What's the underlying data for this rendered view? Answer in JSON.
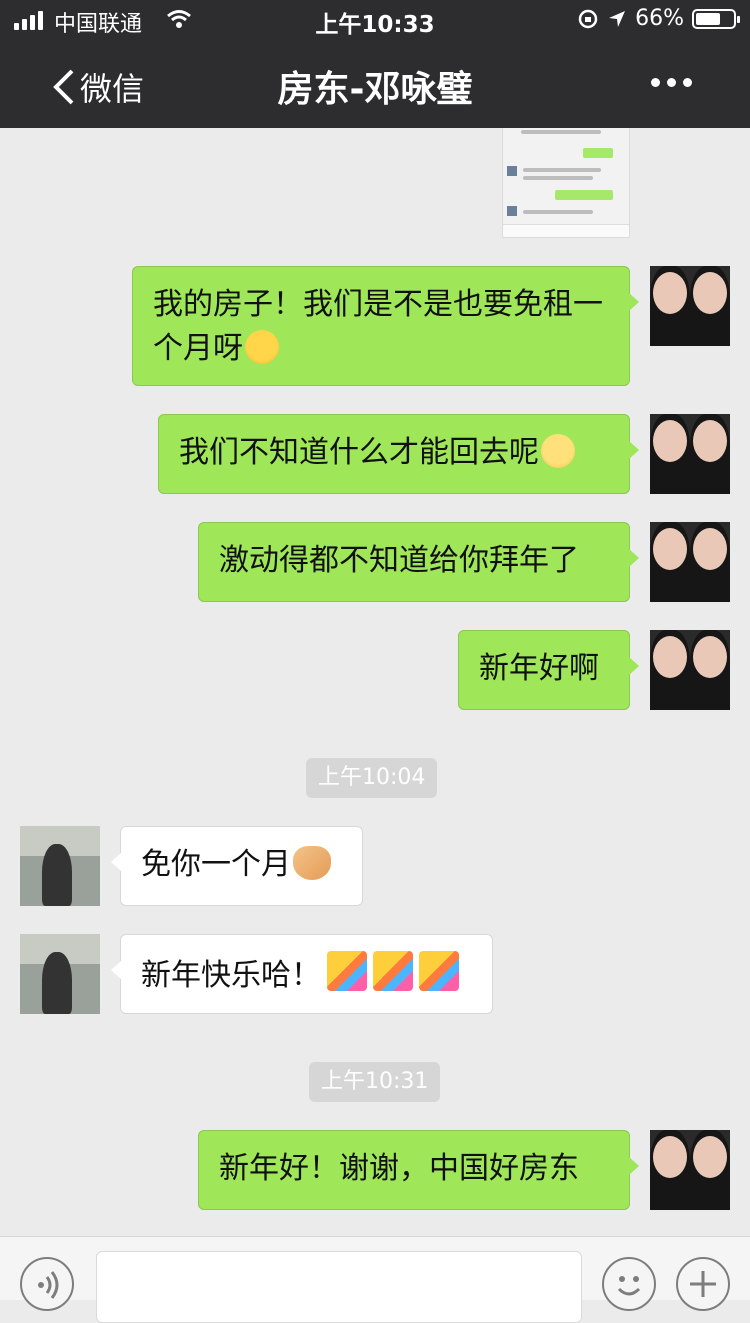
{
  "status": {
    "carrier": "中国联通",
    "time": "上午10:33",
    "battery": "66%",
    "battery_level": 0.66
  },
  "nav": {
    "back_label": "微信",
    "title": "房东-邓咏璧"
  },
  "messages": [
    {
      "side": "out",
      "text": "我的房子！我们是不是也要免租一个月呀",
      "emoji": "laugh-emoji"
    },
    {
      "side": "out",
      "text": "我们不知道什么才能回去呢",
      "emoji": "sad-emoji"
    },
    {
      "side": "out",
      "text": "激动得都不知道给你拜年了"
    },
    {
      "side": "out",
      "text": "新年好啊"
    },
    {
      "timestamp": "上午10:04"
    },
    {
      "side": "in",
      "text": "免你一个月",
      "emoji": "handshake-emoji"
    },
    {
      "side": "in",
      "text": "新年快乐哈！",
      "emoji": "party-popper-emoji x3"
    },
    {
      "timestamp": "上午10:31"
    },
    {
      "side": "out",
      "text": "新年好！谢谢，中国好房东"
    }
  ],
  "icons": {
    "signal": "signal-icon",
    "wifi": "wifi-icon",
    "rotation_lock": "rotation-lock-icon",
    "location": "location-arrow-icon",
    "battery": "battery-icon",
    "back": "chevron-left-icon",
    "more": "more-dots-icon",
    "voice": "voice-icon",
    "emoji": "emoji-icon",
    "add": "plus-icon"
  }
}
